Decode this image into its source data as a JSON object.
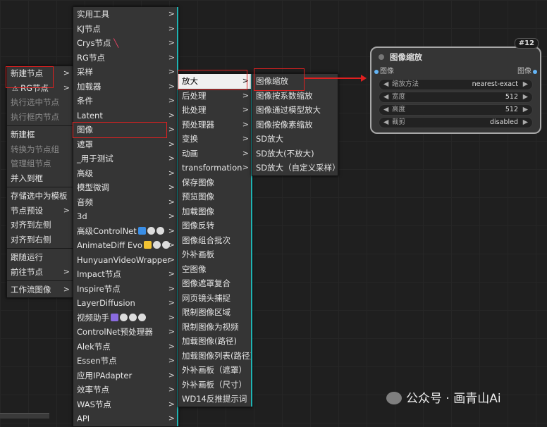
{
  "menu1": {
    "items": [
      {
        "label": "新建节点",
        "arrow": true
      },
      {
        "label": "RG节点",
        "arrow": true,
        "icon": true
      },
      {
        "label": "执行选中节点",
        "disabled": true
      },
      {
        "label": "执行框内节点",
        "disabled": true
      },
      {
        "sep": true
      },
      {
        "label": "新建框"
      },
      {
        "label": "转换为节点组",
        "disabled": true
      },
      {
        "label": "管理组节点",
        "disabled": true
      },
      {
        "label": "并入到框"
      },
      {
        "sep": true
      },
      {
        "label": "存储选中为模板"
      },
      {
        "label": "节点预设",
        "arrow": true
      },
      {
        "label": "对齐到左侧"
      },
      {
        "label": "对齐到右侧"
      },
      {
        "sep": true
      },
      {
        "label": "跟随运行"
      },
      {
        "label": "前往节点",
        "arrow": true
      },
      {
        "sep": true
      },
      {
        "label": "工作流图像",
        "arrow": true
      }
    ]
  },
  "menu2": {
    "items": [
      "实用工具",
      "KJ节点",
      "Crys节点",
      "RG节点",
      "采样",
      "加载器",
      "条件",
      "Latent",
      "图像",
      "遮罩",
      "_用于测试",
      "高级",
      "模型微调",
      "音频",
      "3d",
      "高级ControlNet",
      "AnimateDiff Evo",
      "HunyuanVideoWrapper",
      "Impact节点",
      "Inspire节点",
      "LayerDiffusion",
      "视频助手",
      "ControlNet预处理器",
      "Alek节点",
      "Essen节点",
      "应用IPAdapter",
      "效率节点",
      "WAS节点",
      "API"
    ]
  },
  "menu3": {
    "items": [
      {
        "label": "放大",
        "arrow": true
      },
      {
        "label": "后处理",
        "arrow": true
      },
      {
        "label": "批处理",
        "arrow": true
      },
      {
        "label": "预处理器",
        "arrow": true
      },
      {
        "label": "变换",
        "arrow": true
      },
      {
        "label": "动画",
        "arrow": true
      },
      {
        "label": "transformation",
        "arrow": true
      },
      {
        "label": "保存图像"
      },
      {
        "label": "预览图像"
      },
      {
        "label": "加载图像"
      },
      {
        "label": "图像反转"
      },
      {
        "label": "图像组合批次"
      },
      {
        "label": "外补画板"
      },
      {
        "label": "空图像"
      },
      {
        "label": "图像遮罩复合"
      },
      {
        "label": "网页镜头捕捉"
      },
      {
        "label": "限制图像区域"
      },
      {
        "label": "限制图像为视频"
      },
      {
        "label": "加载图像(路径)"
      },
      {
        "label": "加载图像列表(路径)"
      },
      {
        "label": "外补画板（遮罩）"
      },
      {
        "label": "外补画板（尺寸）"
      },
      {
        "label": "WD14反推提示词"
      }
    ]
  },
  "menu4": {
    "items": [
      "图像缩放",
      "图像按系数缩放",
      "图像通过模型放大",
      "图像按像素缩放",
      "SD放大",
      "SD放大(不放大)",
      "SD放大（自定义采样）"
    ]
  },
  "node": {
    "id": "#12",
    "title": "图像缩放",
    "input": "图像",
    "output": "图像",
    "widgets": [
      {
        "name": "缩放方法",
        "value": "nearest-exact"
      },
      {
        "name": "宽度",
        "value": "512"
      },
      {
        "name": "高度",
        "value": "512"
      },
      {
        "name": "裁剪",
        "value": "disabled"
      }
    ]
  },
  "watermark": "公众号 · 画青山Ai",
  "colors": {
    "highlight_box": "#e02020",
    "submenu_bar": "#1fb3b3",
    "menu_bg": "#353535"
  }
}
